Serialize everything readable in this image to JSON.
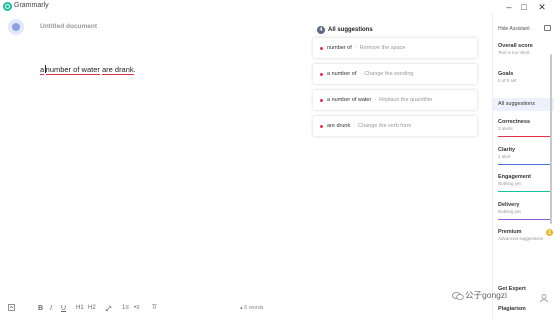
{
  "app": {
    "title": "Grammarly"
  },
  "document": {
    "title": "Untitled document",
    "text": {
      "part1": "a",
      "part2": "number  of water",
      "part3": " ",
      "part4": "are drank",
      "part5": "."
    }
  },
  "toolbar": {
    "bold": "B",
    "italic": "I",
    "underline": "U",
    "h1": "H1",
    "h2": "H2",
    "link": "🔗",
    "ordered_list": "1≡",
    "bullet_list": "•≡",
    "clear": "T̸",
    "word_count": "6 words",
    "word_count_arrow": "▴"
  },
  "suggestions": {
    "count": "4",
    "title": "All suggestions",
    "cards": [
      {
        "text": "number of",
        "sep": "·",
        "desc": "Remove the space"
      },
      {
        "text": "a number of",
        "sep": "·",
        "desc": "Change the wording"
      },
      {
        "text": "a number of water",
        "sep": "·",
        "desc": "Replace the quantifier"
      },
      {
        "text": "are drunk",
        "sep": "·",
        "desc": "Change the verb form"
      }
    ]
  },
  "sidebar": {
    "hide_assistant": "Hide Assistant",
    "overall": {
      "label": "Overall score",
      "sub": "Text is too short"
    },
    "goals": {
      "label": "Goals",
      "sub": "5 of 5 set"
    },
    "all_suggestions": "All suggestions",
    "correctness": {
      "label": "Correctness",
      "sub": "3 alerts",
      "color": "#e0344b"
    },
    "clarity": {
      "label": "Clarity",
      "sub": "1 alert",
      "color": "#4a6ee0"
    },
    "engagement": {
      "label": "Engagement",
      "sub": "Nothing yet",
      "color": "#15c39a"
    },
    "delivery": {
      "label": "Delivery",
      "sub": "Nothing yet",
      "color": "#8a5cd6"
    },
    "premium": {
      "label": "Premium",
      "sub": "Advanced suggestions",
      "badge": "1"
    },
    "get_expert": "Get Expert",
    "plagiarism": "Plagiarism"
  },
  "watermark": {
    "text": "公子gongzi"
  },
  "colors": {
    "accent": "#15c39a",
    "error": "#e0344b"
  }
}
